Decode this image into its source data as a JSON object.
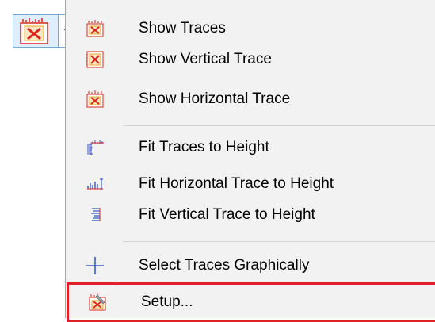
{
  "toolbar": {
    "main_icon": "traces-icon",
    "dropdown_icon": "chevron-down-icon"
  },
  "menu": {
    "items": [
      {
        "label": "Show Traces",
        "icon": "show-traces-icon"
      },
      {
        "label": "Show Vertical Trace",
        "icon": "show-vertical-trace-icon"
      },
      {
        "label": "Show Horizontal Trace",
        "icon": "show-horizontal-trace-icon"
      },
      {
        "label": "Fit Traces to Height",
        "icon": "fit-traces-height-icon"
      },
      {
        "label": "Fit Horizontal Trace to Height",
        "icon": "fit-horizontal-trace-icon"
      },
      {
        "label": "Fit Vertical Trace to Height",
        "icon": "fit-vertical-trace-icon"
      },
      {
        "label": "Select Traces Graphically",
        "icon": "crosshair-icon"
      },
      {
        "label": "Setup...",
        "icon": "setup-icon"
      }
    ]
  },
  "colors": {
    "highlight_border": "#e0202e",
    "menu_background": "#f2f2f2",
    "icon_red": "#d9261c",
    "icon_orange": "#f5a623",
    "icon_blue": "#3a5bc7"
  }
}
